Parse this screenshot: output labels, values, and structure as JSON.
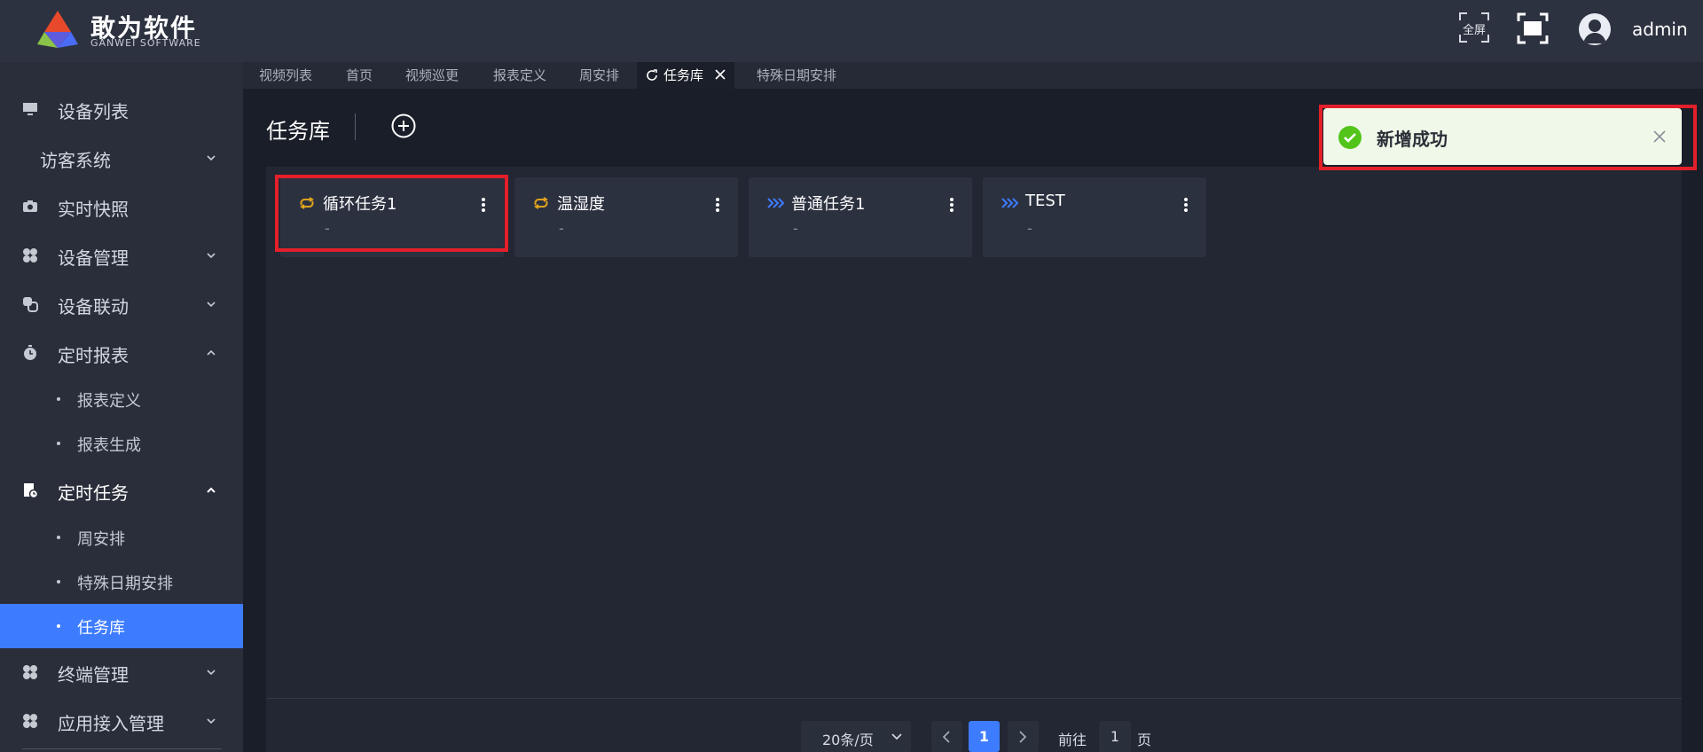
{
  "header": {
    "brand_title": "敢为软件",
    "brand_subtitle": "GANWEI SOFTWARE",
    "fullscreen_text": "全屏",
    "username": "admin"
  },
  "sidebar": {
    "items": [
      {
        "label": "设备列表",
        "icon": "monitor-icon"
      },
      {
        "label": "访客系统"
      },
      {
        "label": "实时快照",
        "icon": "camera-icon"
      },
      {
        "label": "设备管理",
        "icon": "grid-icon"
      },
      {
        "label": "设备联动",
        "icon": "link-icon"
      },
      {
        "label": "定时报表",
        "icon": "timer-icon",
        "sub": [
          "报表定义",
          "报表生成"
        ]
      },
      {
        "label": "定时任务",
        "icon": "task-icon",
        "sub": [
          "周安排",
          "特殊日期安排",
          "任务库"
        ]
      },
      {
        "label": "终端管理",
        "icon": "grid-icon"
      },
      {
        "label": "应用接入管理",
        "icon": "grid-icon"
      }
    ],
    "active_item": "任务库"
  },
  "tabs": [
    "视频列表",
    "首页",
    "视频巡更",
    "报表定义",
    "周安排",
    "任务库",
    "特殊日期安排"
  ],
  "active_tab": "任务库",
  "page": {
    "title": "任务库"
  },
  "cards": [
    {
      "title": "循环任务1",
      "subtitle": "-",
      "icon": "loop-icon"
    },
    {
      "title": "温湿度",
      "subtitle": "-",
      "icon": "loop-icon"
    },
    {
      "title": "普通任务1",
      "subtitle": "-",
      "icon": "forward-icon"
    },
    {
      "title": "TEST",
      "subtitle": "-",
      "icon": "forward-icon"
    }
  ],
  "toast": {
    "message": "新增成功",
    "type": "success"
  },
  "pagination": {
    "page_size_label": "20条/页",
    "current_page": "1",
    "goto_label": "前往",
    "goto_value": "1",
    "page_suffix": "页"
  },
  "colors": {
    "accent": "#3d7cff",
    "success": "#52c41a",
    "highlight": "#e3202a",
    "loop_icon": "#e0a31e",
    "forward_icon": "#3d7cff"
  }
}
